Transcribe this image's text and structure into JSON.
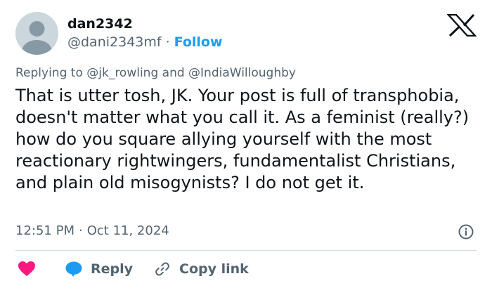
{
  "author": {
    "name": "dan2342",
    "handle": "@dani2343mf",
    "separator": "·",
    "follow_label": "Follow"
  },
  "reply_context": {
    "prefix": "Replying to",
    "mention1": "@jk_rowling",
    "conjunction": "and",
    "mention2": "@IndiaWilloughby"
  },
  "tweet": {
    "text": "That is utter tosh, JK. Your post is full of transphobia, doesn't matter what you call it. As a feminist (really?) how do you square allying yourself with the most reactionary rightwingers, fundamentalist Christians, and plain old misogynists? I do not get it.",
    "time": "12:51 PM",
    "separator": "·",
    "date": "Oct 11, 2024"
  },
  "actions": {
    "reply_label": "Reply",
    "copy_label": "Copy link"
  },
  "colors": {
    "heart": "#f91880",
    "reply_bubble": "#1d9bf0",
    "follow": "#1d9bf0",
    "secondary_text": "#536471"
  },
  "icons": [
    "x-logo-icon",
    "info-icon",
    "heart-icon",
    "reply-bubble-icon",
    "link-icon"
  ]
}
